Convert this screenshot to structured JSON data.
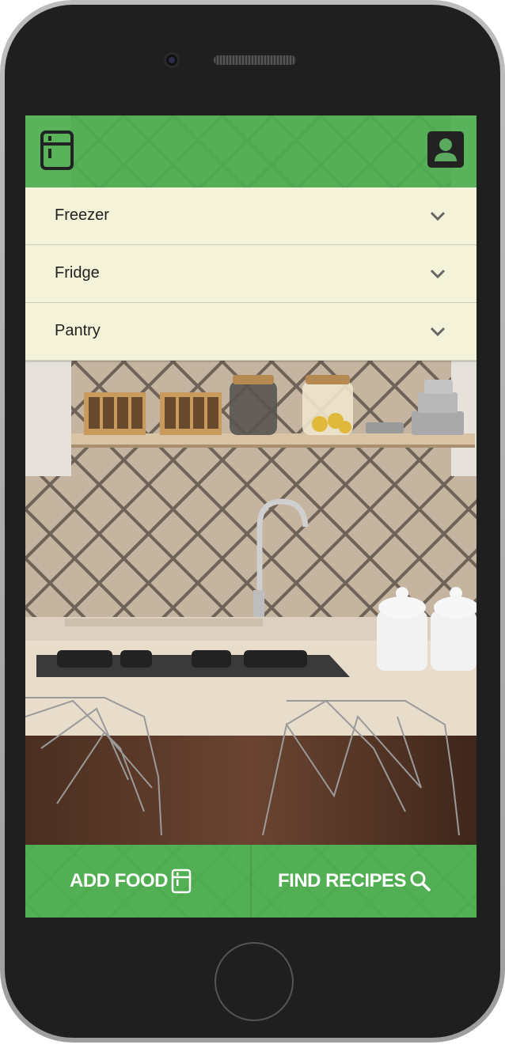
{
  "app": {
    "header": {
      "left_icon": "fridge-icon",
      "right_icon": "account-box-icon"
    },
    "storage_panels": [
      {
        "label": "Freezer",
        "icon": "chevron-down-icon"
      },
      {
        "label": "Fridge",
        "icon": "chevron-down-icon"
      },
      {
        "label": "Pantry",
        "icon": "chevron-down-icon"
      }
    ],
    "bottom_actions": {
      "add_food_label": "ADD FOOD",
      "add_food_icon": "fridge-icon",
      "find_recipes_label": "FIND RECIPES",
      "find_recipes_icon": "search-icon"
    }
  },
  "colors": {
    "accent_green": "#4caf50",
    "panel_bg": "#f4f3d9",
    "icon_dark": "#222222"
  }
}
